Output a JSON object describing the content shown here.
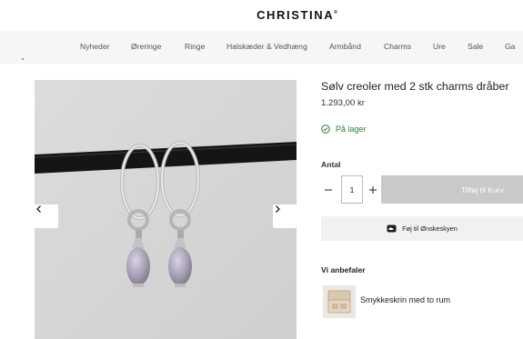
{
  "header": {
    "logo": "CHRISTINA",
    "logo_mark": "®"
  },
  "nav": {
    "items": [
      {
        "label": "Nyheder"
      },
      {
        "label": "Øreringe"
      },
      {
        "label": "Ringe"
      },
      {
        "label": "Halskæder & Vedhæng"
      },
      {
        "label": "Armbånd"
      },
      {
        "label": "Charms"
      },
      {
        "label": "Ure"
      },
      {
        "label": "Sale"
      },
      {
        "label": "Ga"
      }
    ]
  },
  "gallery": {
    "prev_icon": "chevron-left-icon",
    "next_icon": "chevron-right-icon"
  },
  "product": {
    "title": "Sølv creoler med 2 stk charms dråber",
    "price": "1.293,00 kr",
    "stock": {
      "label": "På lager",
      "icon": "check-circle-icon",
      "color": "#2f7a3e"
    }
  },
  "purchase": {
    "quantity_label": "Antal",
    "quantity_value": "1",
    "minus_icon": "minus-icon",
    "plus_icon": "plus-icon",
    "add_to_cart": "Tilføj til Kurv",
    "cart_button_color": "#c9c9c9"
  },
  "wishlist": {
    "label": "Føj til Ønskeskyen",
    "icon": "cloud-icon"
  },
  "recommendations": {
    "title": "Vi anbefaler",
    "items": [
      {
        "name": "Smykkeskrin med to rum"
      }
    ]
  }
}
